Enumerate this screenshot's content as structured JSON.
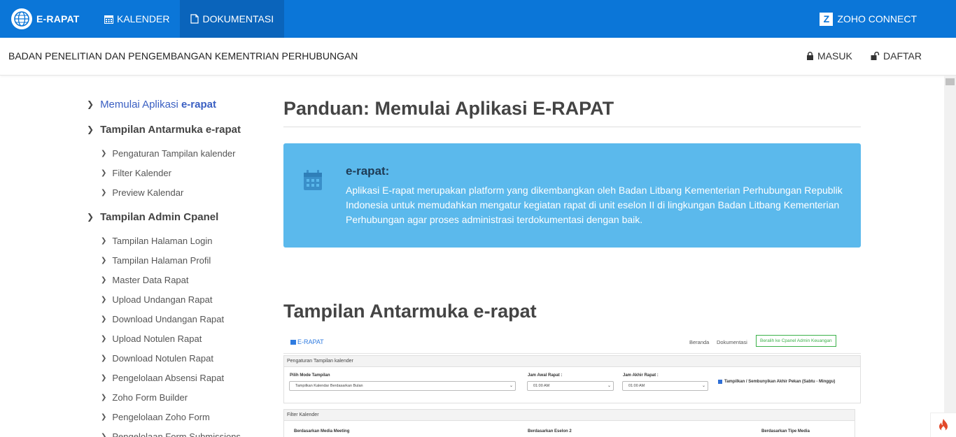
{
  "brand": {
    "name": "E-RAPAT"
  },
  "nav": {
    "kalender": "KALENDER",
    "dokumentasi": "DOKUMENTASI",
    "zoho": "ZOHO CONNECT"
  },
  "subheader": {
    "org": "BADAN PENELITIAN DAN PENGEMBANGAN KEMENTRIAN PERHUBUNGAN",
    "masuk": "MASUK",
    "daftar": "DAFTAR"
  },
  "sidebar": {
    "s1": {
      "label": "Memulai Aplikasi ",
      "em": "e-rapat"
    },
    "s2": {
      "label": "Tampilan Antarmuka e-rapat"
    },
    "s2_items": [
      "Pengaturan Tampilan kalender",
      "Filter Kalender",
      "Preview Kalendar"
    ],
    "s3": {
      "label": "Tampilan Admin Cpanel"
    },
    "s3_items": [
      "Tampilan Halaman Login",
      "Tampilan Halaman Profil",
      "Master Data Rapat",
      "Upload Undangan Rapat",
      "Download Undangan Rapat",
      "Upload Notulen Rapat",
      "Download Notulen Rapat",
      "Pengelolaan Absensi Rapat",
      "Zoho Form Builder",
      "Pengelolaan Zoho Form",
      "Pengelolaan Form Submissions"
    ]
  },
  "main": {
    "title": "Panduan: Memulai Aplikasi E-RAPAT",
    "callout_title": "e-rapat:",
    "callout_body": "Aplikasi E-rapat merupakan platform yang dikembangkan oleh Badan Litbang Kementerian Perhubungan Republik Indonesia untuk memudahkan mengatur kegiatan rapat di unit eselon II di lingkungan Badan Litbang Kementerian Perhubungan agar proses administrasi terdokumentasi dengan baik.",
    "section2_title": "Tampilan Antarmuka e-rapat"
  },
  "screenshot": {
    "brand": "E-RAPAT",
    "beranda": "Beranda",
    "dokumentasi": "Dokumentasi",
    "cpanel_btn": "Beralih ke Cpanel Admin Keuangan",
    "panel1": "Pengaturan Tampilan kalender",
    "mode_label": "Pilih Mode Tampilan",
    "mode_value": "Tampilkan Kalendar Berdasarkan Bulan",
    "awal_label": "Jam Awal Rapat :",
    "awal_value": "01:00 AM",
    "akhir_label": "Jam Akhir Rapat :",
    "akhir_value": "01:00 AM",
    "weekend": "Tampilkan / Sembunyikan Akhir Pekan (Sabtu - Minggu)",
    "panel2": "Filter Kalender",
    "media": "Berdasarkan Media Meeting",
    "eselon": "Berdasarkan Eselon 2",
    "tipe": "Berdasarkan Tipe Media"
  }
}
